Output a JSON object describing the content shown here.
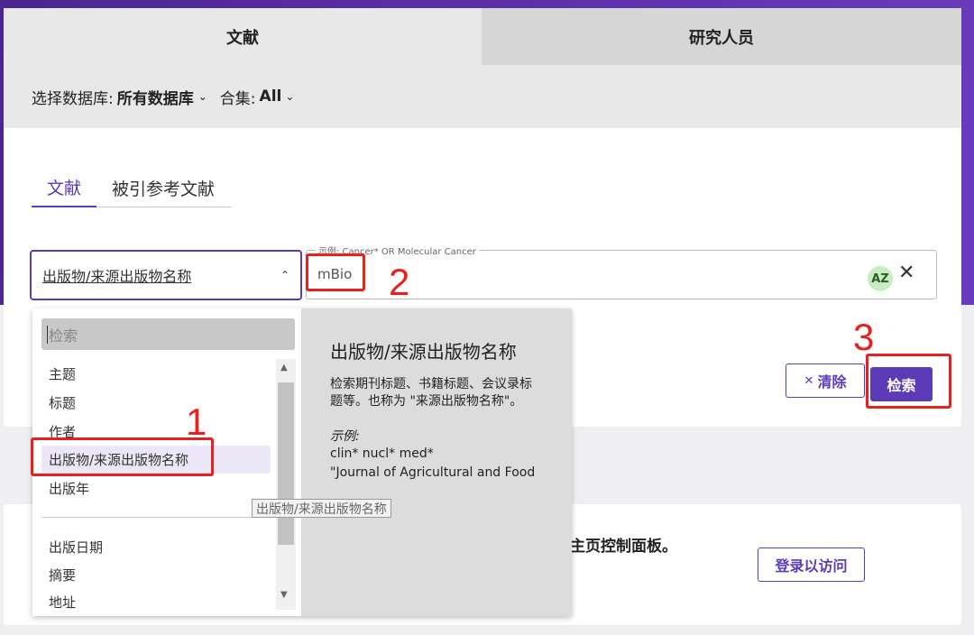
{
  "top_tabs": [
    {
      "label": "文献"
    },
    {
      "label": "研究人员"
    }
  ],
  "database": {
    "label": "选择数据库:",
    "value": "所有数据库",
    "collection_label": "合集:",
    "collection_value": "All"
  },
  "sub_tabs": [
    {
      "label": "文献"
    },
    {
      "label": "被引参考文献"
    }
  ],
  "field_select": {
    "value": "出版物/来源出版物名称"
  },
  "search_box": {
    "legend": "示例: Cancer* OR Molecular Cancer",
    "value": "mBio"
  },
  "az_label": "AZ",
  "actions": {
    "clear": "清除",
    "search": "检索"
  },
  "dropdown": {
    "search_placeholder": "检索",
    "items": [
      "主题",
      "标题",
      "作者",
      "出版物/来源出版物名称",
      "出版年",
      "出版日期",
      "摘要",
      "地址"
    ],
    "selected_index": 3,
    "info_title": "出版物/来源出版物名称",
    "info_desc": "检索期刊标题、书籍标题、会议录标题等。也称为 \"来源出版物名称\"。",
    "example_label": "示例:",
    "examples": [
      "clin* nucl* med*",
      "\"Journal of Agricultural and Food"
    ]
  },
  "tooltip": "出版物/来源出版物名称",
  "lower_card": {
    "message": "主页控制面板。",
    "login": "登录以访问"
  },
  "annotations": [
    "1",
    "2",
    "3"
  ],
  "colors": {
    "accent": "#5b3bb8",
    "annotation": "#e8201f",
    "hero": "#5a2fa8"
  }
}
